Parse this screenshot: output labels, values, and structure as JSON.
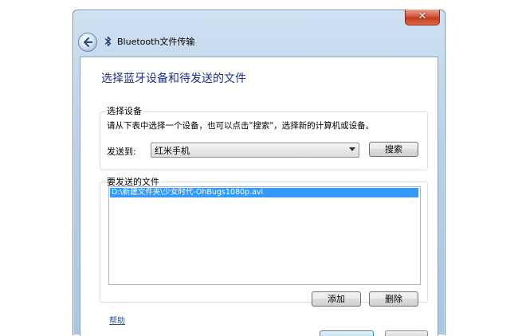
{
  "window": {
    "title": "Bluetooth文件传输",
    "close_glyph": "✕"
  },
  "heading": "选择蓝牙设备和待发送的文件",
  "device_group": {
    "label": "选择设备",
    "instruction": "请从下表中选择一个设备，也可以点击\"搜索\"，选择新的计算机或设备。",
    "send_to_label": "发送到:",
    "selected_device": "红米手机",
    "search_button": "搜索"
  },
  "files_group": {
    "label": "要发送的文件",
    "files": [
      "D:\\新建文件夹\\少女时代-OhBugs1080p.avi"
    ],
    "add_button": "添加",
    "delete_button": "删除"
  },
  "help_link": "帮助",
  "colors": {
    "heading": "#1e3287",
    "selection": "#3399ff",
    "link": "#1e50b4"
  }
}
